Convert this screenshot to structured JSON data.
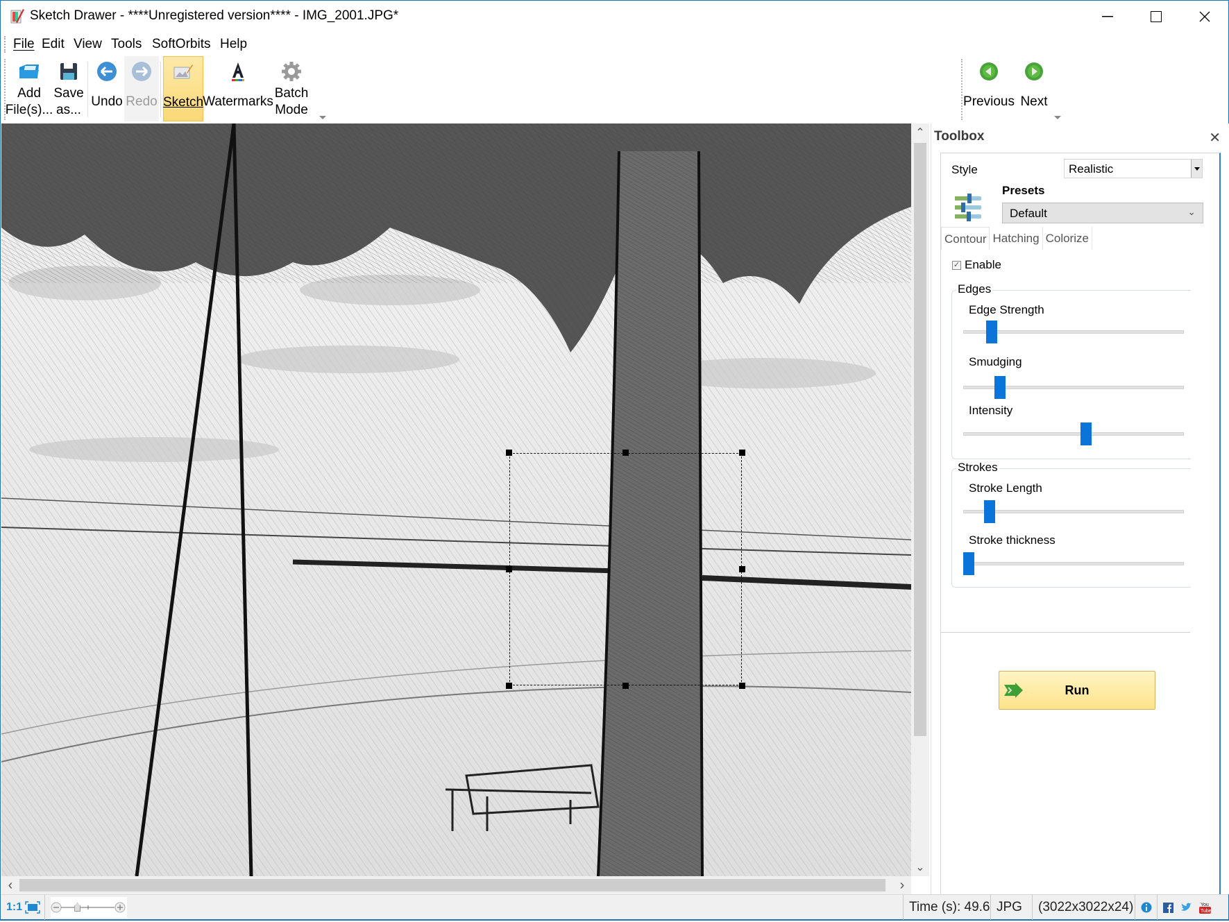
{
  "window": {
    "title": "Sketch Drawer - ****Unregistered version**** - IMG_2001.JPG*",
    "controls": [
      "minimize",
      "maximize",
      "close"
    ]
  },
  "menu": {
    "items": [
      {
        "label": "File",
        "accel": "F"
      },
      {
        "label": "Edit",
        "accel": "E"
      },
      {
        "label": "View",
        "accel": "V"
      },
      {
        "label": "Tools",
        "accel": "T"
      },
      {
        "label": "SoftOrbits",
        "accel": ""
      },
      {
        "label": "Help",
        "accel": "H"
      }
    ]
  },
  "toolbar": {
    "add_files": {
      "label": "Add\nFile(s)...",
      "icon": "open-folder-icon"
    },
    "save_as": {
      "label": "Save\nas...",
      "icon": "floppy-disk-icon"
    },
    "undo": {
      "label": "Undo",
      "icon": "arrow-left-circle-icon"
    },
    "redo": {
      "label": "Redo",
      "icon": "arrow-right-circle-icon",
      "disabled": true
    },
    "sketch": {
      "label": "Sketch",
      "icon": "sketch-picture-icon",
      "active": true
    },
    "watermarks": {
      "label": "Watermarks",
      "icon": "letter-a-icon"
    },
    "batch_mode": {
      "label": "Batch\nMode",
      "icon": "gear-icon"
    },
    "previous": {
      "label": "Previous",
      "icon": "green-left-arrow-icon"
    },
    "next": {
      "label": "Next",
      "icon": "green-right-arrow-icon"
    }
  },
  "canvas": {
    "image_description": "Pencil sketch of a tree trunk, a tall pole, a bench and a sea horizon",
    "selection": {
      "handles": 8
    }
  },
  "toolbox": {
    "title": "Toolbox",
    "style_label": "Style",
    "style_value": "Realistic",
    "presets_label": "Presets",
    "presets_value": "Default",
    "tabs": [
      {
        "label": "Contour",
        "active": true
      },
      {
        "label": "Hatching",
        "active": false
      },
      {
        "label": "Colorize",
        "active": false
      }
    ],
    "enable_label": "Enable",
    "enable_checked": true,
    "edges_group": {
      "legend": "Edges",
      "sliders": [
        {
          "label": "Edge Strength",
          "value": 0.11
        },
        {
          "label": "Smudging",
          "value": 0.15
        },
        {
          "label": "Intensity",
          "value": 0.56
        }
      ]
    },
    "strokes_group": {
      "legend": "Strokes",
      "sliders": [
        {
          "label": "Stroke Length",
          "value": 0.1
        },
        {
          "label": "Stroke thickness",
          "value": 0.0
        }
      ]
    },
    "run_label": "Run"
  },
  "statusbar": {
    "one_to_one": "1:1",
    "time": "Time (s): 49.6",
    "format": "JPG",
    "dimensions": "(3022x3022x24)",
    "zoom_fraction": 0.3
  },
  "colors": {
    "accent_blue": "#0a74d8",
    "active_tool_bg": "#fbd876",
    "run_button_bg": "#fde38a",
    "window_border": "#1e73b4"
  }
}
